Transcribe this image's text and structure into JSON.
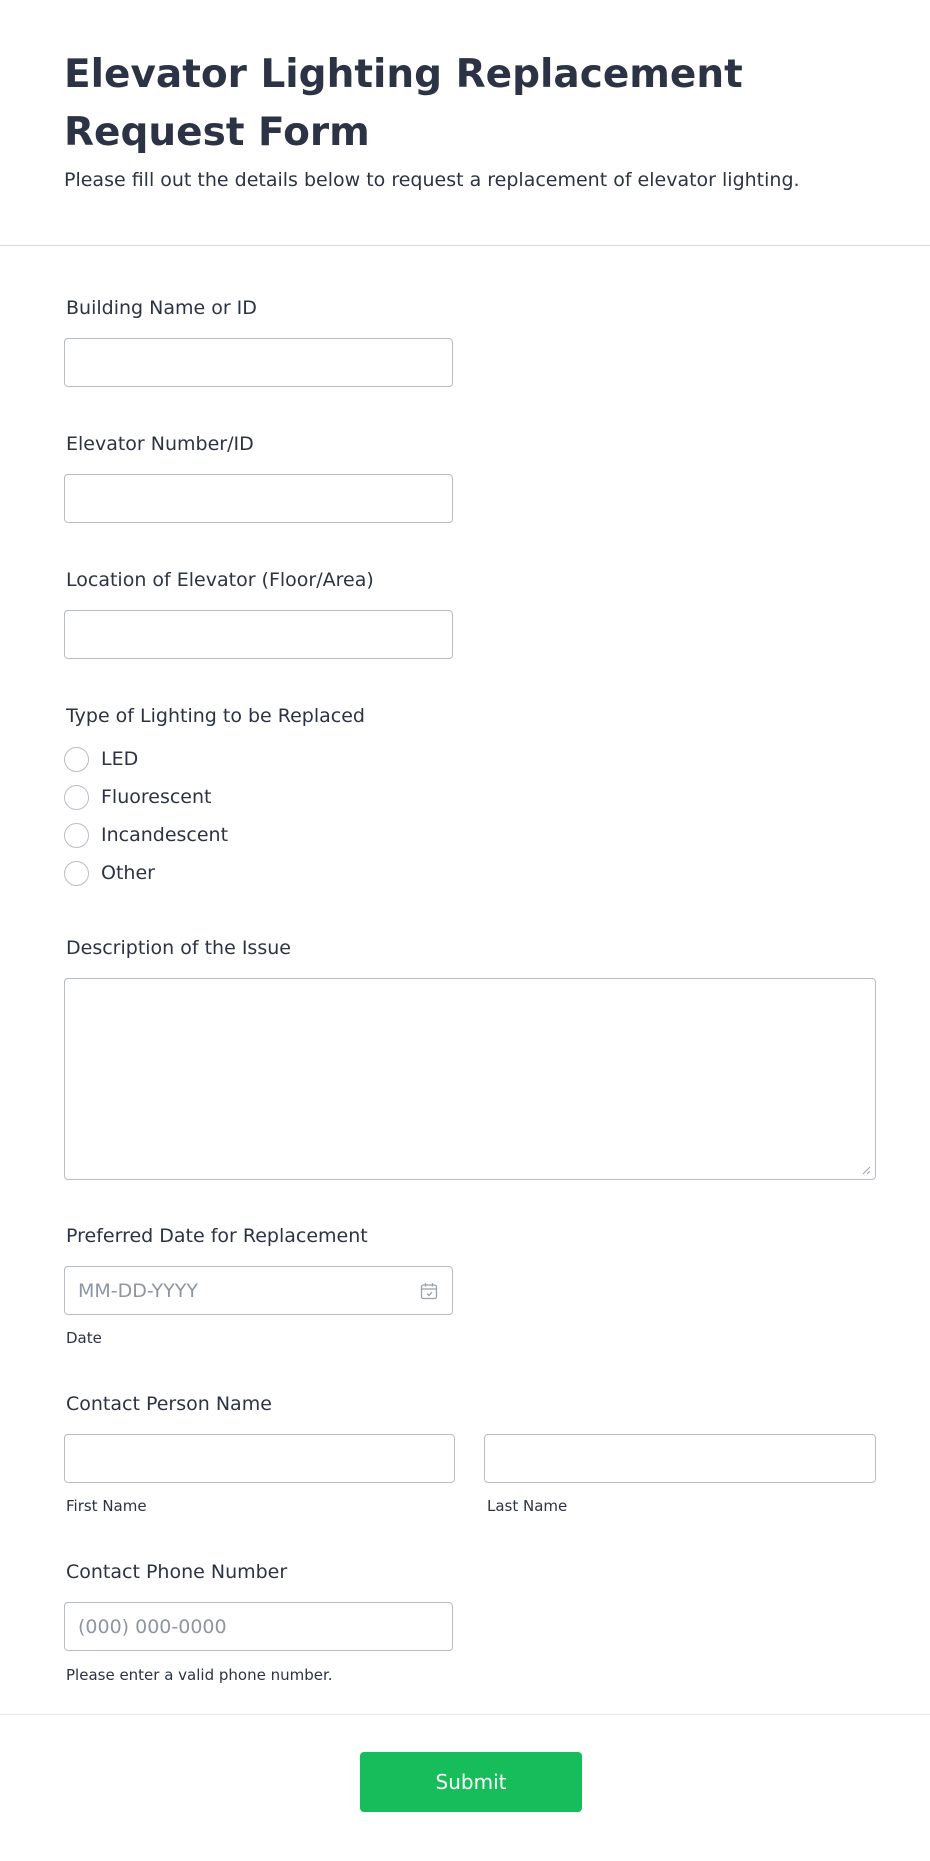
{
  "form": {
    "title": "Elevator Lighting Replacement Request Form",
    "subtitle": "Please fill out the details below to request a replacement of elevator lighting."
  },
  "fields": {
    "building": {
      "label": "Building Name or ID",
      "value": ""
    },
    "elevator": {
      "label": "Elevator Number/ID",
      "value": ""
    },
    "location": {
      "label": "Location of Elevator (Floor/Area)",
      "value": ""
    },
    "lighting_type": {
      "label": "Type of Lighting to be Replaced",
      "options": [
        "LED",
        "Fluorescent",
        "Incandescent",
        "Other"
      ]
    },
    "description": {
      "label": "Description of the Issue",
      "value": ""
    },
    "date": {
      "label": "Preferred Date for Replacement",
      "placeholder": "MM-DD-YYYY",
      "sublabel": "Date",
      "icon": "calendar-icon"
    },
    "contact_name": {
      "label": "Contact Person Name",
      "first_sublabel": "First Name",
      "last_sublabel": "Last Name"
    },
    "phone": {
      "label": "Contact Phone Number",
      "placeholder": "(000) 000-0000",
      "sublabel": "Please enter a valid phone number."
    }
  },
  "submit": {
    "label": "Submit"
  },
  "colors": {
    "accent": "#18bd5b",
    "text": "#2c3345",
    "border": "#b8bdc9",
    "placeholder": "#8f96a3"
  }
}
